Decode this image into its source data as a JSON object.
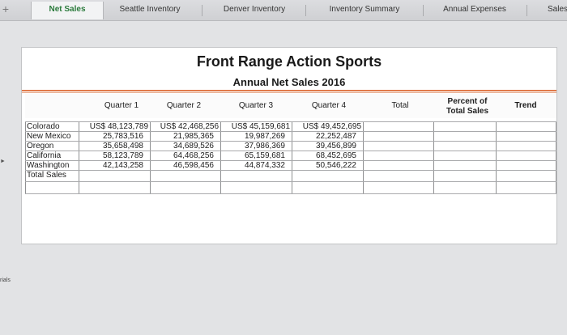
{
  "tabs": {
    "add": "+",
    "items": [
      "Net Sales",
      "Seattle Inventory",
      "Denver Inventory",
      "Inventory Summary",
      "Annual Expenses"
    ],
    "overflow": "Sales"
  },
  "side": {
    "label": "rials"
  },
  "sheet": {
    "title": "Front Range Action Sports",
    "subtitle": "Annual Net Sales 2016",
    "headers": [
      "Quarter 1",
      "Quarter 2",
      "Quarter 3",
      "Quarter 4",
      "Total"
    ],
    "percent_header_line1": "Percent of",
    "percent_header_line2": "Total Sales",
    "trend_header": "Trend",
    "rows": [
      {
        "label": "Colorado",
        "q": [
          "US$ 48,123,789",
          "US$ 42,468,256",
          "US$ 45,159,681",
          "US$ 49,452,695"
        ]
      },
      {
        "label": "New Mexico",
        "q": [
          "25,783,516",
          "21,985,365",
          "19,987,269",
          "22,252,487"
        ]
      },
      {
        "label": "Oregon",
        "q": [
          "35,658,498",
          "34,689,526",
          "37,986,369",
          "39,456,899"
        ]
      },
      {
        "label": "California",
        "q": [
          "58,123,789",
          "64,468,256",
          "65,159,681",
          "68,452,695"
        ]
      },
      {
        "label": "Washington",
        "q": [
          "42,143,258",
          "46,598,456",
          "44,874,332",
          "50,546,222"
        ]
      },
      {
        "label": "Total Sales",
        "q": [
          "",
          "",
          "",
          ""
        ]
      }
    ]
  },
  "colors": {
    "active_tab_text": "#2a7a3b",
    "accent_rule": "#e07a4a"
  }
}
